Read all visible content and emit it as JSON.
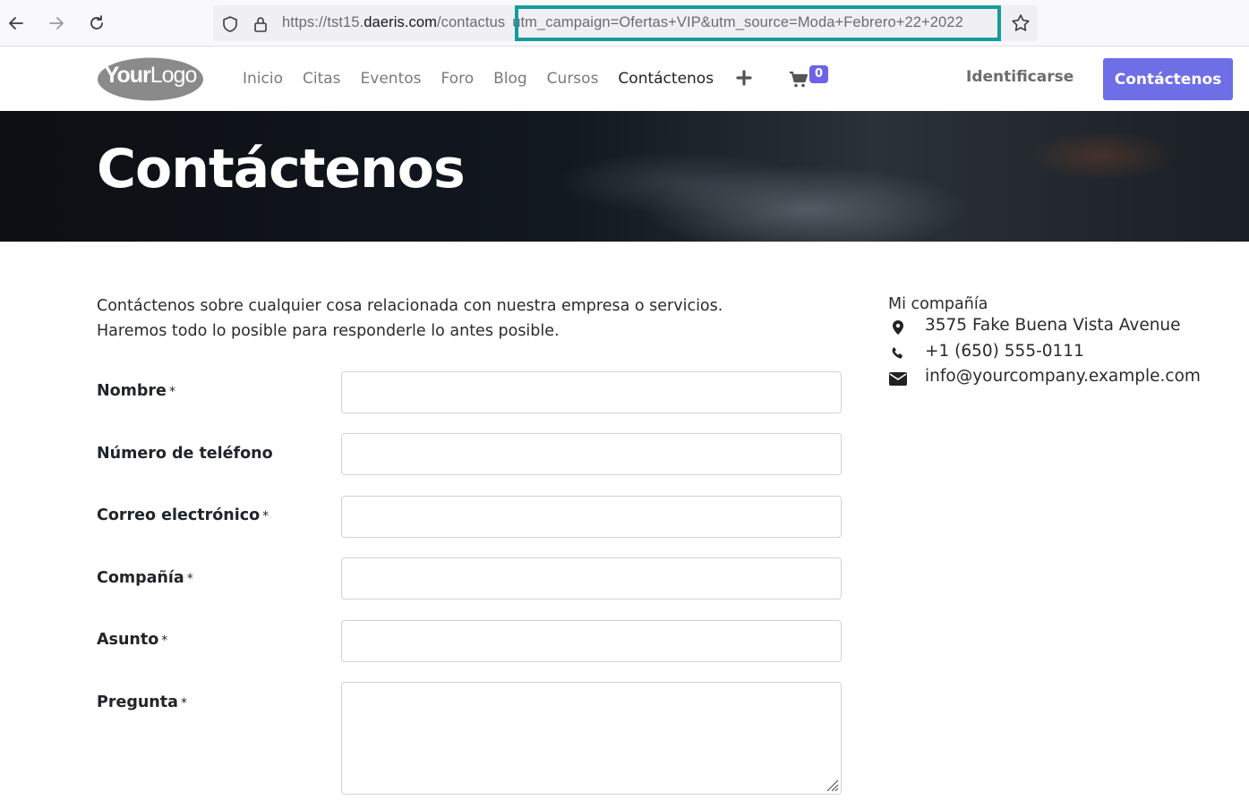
{
  "browser": {
    "url_prefix": "https://tst15.",
    "url_host": "daeris.com",
    "url_path": "/contactus",
    "url_query": "utm_campaign=Ofertas+VIP&utm_source=Moda+Febrero+22+2022",
    "highlight_color": "#139c9c"
  },
  "header": {
    "logo_bold": "Your",
    "logo_light": "Logo",
    "menu": [
      {
        "label": "Inicio"
      },
      {
        "label": "Citas"
      },
      {
        "label": "Eventos"
      },
      {
        "label": "Foro"
      },
      {
        "label": "Blog"
      },
      {
        "label": "Cursos"
      },
      {
        "label": "Contáctenos"
      }
    ],
    "cart_count": "0",
    "login_label": "Identificarse",
    "cta_label": "Contáctenos",
    "accent_color": "#6e6ee6"
  },
  "hero": {
    "title": "Contáctenos"
  },
  "main": {
    "intro_line1": "Contáctenos sobre cualquier cosa relacionada con nuestra empresa o servicios.",
    "intro_line2": "Haremos todo lo posible para responderle lo antes posible.",
    "form": {
      "required_mark": "*",
      "fields": [
        {
          "label": "Nombre",
          "value": ""
        },
        {
          "label": "Número de teléfono",
          "value": ""
        },
        {
          "label": "Correo electrónico",
          "value": ""
        },
        {
          "label": "Compañía",
          "value": ""
        },
        {
          "label": "Asunto",
          "value": ""
        },
        {
          "label": "Pregunta",
          "value": ""
        }
      ]
    }
  },
  "sidebar": {
    "company_name": "Mi compañía",
    "address": "3575 Fake Buena Vista Avenue",
    "phone": "+1 (650) 555-0111",
    "email": "info@yourcompany.example.com"
  }
}
